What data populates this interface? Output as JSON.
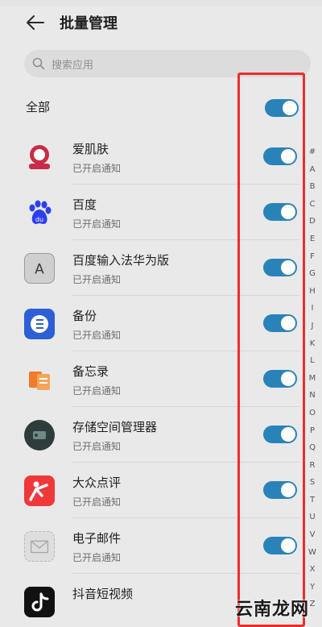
{
  "header": {
    "title": "批量管理"
  },
  "search": {
    "placeholder": "搜索应用"
  },
  "all": {
    "label": "全部",
    "on": true
  },
  "apps": [
    {
      "name": "爱肌肤",
      "status": "已开启通知",
      "icon": "aijifu-icon",
      "color": "#c92a45"
    },
    {
      "name": "百度",
      "status": "已开启通知",
      "icon": "baidu-paw-icon",
      "color": "#2b3ef0"
    },
    {
      "name": "百度输入法华为版",
      "status": "已开启通知",
      "icon": "baidu-input-icon",
      "color": "#4a4a4a"
    },
    {
      "name": "备份",
      "status": "已开启通知",
      "icon": "backup-icon",
      "color": "#2d5fd6"
    },
    {
      "name": "备忘录",
      "status": "已开启通知",
      "icon": "notes-icon",
      "color": "#f07b2a"
    },
    {
      "name": "存储空间管理器",
      "status": "已开启通知",
      "icon": "storage-icon",
      "color": "#2e3d3c"
    },
    {
      "name": "大众点评",
      "status": "已开启通知",
      "icon": "dianping-icon",
      "color": "#f0383a"
    },
    {
      "name": "电子邮件",
      "status": "已开启通知",
      "icon": "email-icon",
      "color": "#c9c9c9"
    },
    {
      "name": "抖音短视频",
      "status": "",
      "icon": "douyin-icon",
      "color": "#111111"
    }
  ],
  "index_letters": [
    "#",
    "A",
    "B",
    "C",
    "D",
    "E",
    "F",
    "G",
    "H",
    "I",
    "J",
    "K",
    "L",
    "M",
    "N",
    "O",
    "P",
    "Q",
    "R",
    "S",
    "T",
    "U",
    "V",
    "W",
    "X",
    "Y",
    "Z"
  ],
  "colors": {
    "toggle_on": "#2a83b8",
    "highlight_box": "#f02b2b"
  },
  "watermark": "云南龙网"
}
